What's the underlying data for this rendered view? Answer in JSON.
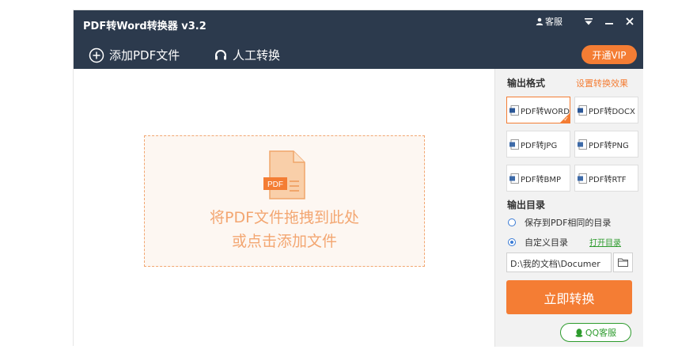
{
  "titlebar": {
    "title": "PDF转Word转换器 v3.2",
    "kefu_label": "客服",
    "icons": [
      "person-icon",
      "dropdown-icon",
      "minimize-icon",
      "close-icon"
    ]
  },
  "toolbar": {
    "add_pdf_label": "添加PDF文件",
    "manual_label": "人工转换",
    "vip_label": "开通VIP"
  },
  "dropzone": {
    "icon_text": "PDF",
    "line1": "将PDF文件拖拽到此处",
    "line2": "或点击添加文件"
  },
  "panel": {
    "format_title": "输出格式",
    "settings_link": "设置转换效果",
    "formats": [
      {
        "label": "PDF转WORD",
        "selected": true
      },
      {
        "label": "PDF转DOCX",
        "selected": false
      },
      {
        "label": "PDF转JPG",
        "selected": false
      },
      {
        "label": "PDF转PNG",
        "selected": false
      },
      {
        "label": "PDF转BMP",
        "selected": false
      },
      {
        "label": "PDF转RTF",
        "selected": false
      }
    ],
    "output_dir_title": "输出目录",
    "radio_same": "保存到PDF相同的目录",
    "radio_custom": "自定义目录",
    "open_dir_link": "打开目录",
    "path_value": "D:\\我的文档\\Documer",
    "convert_label": "立即转换",
    "qq_label": "QQ客服"
  },
  "colors": {
    "titlebar_bg": "#2c3a4d",
    "accent_orange": "#f47d34",
    "drop_text": "#f3a671",
    "qq_green": "#2d9b2d"
  }
}
